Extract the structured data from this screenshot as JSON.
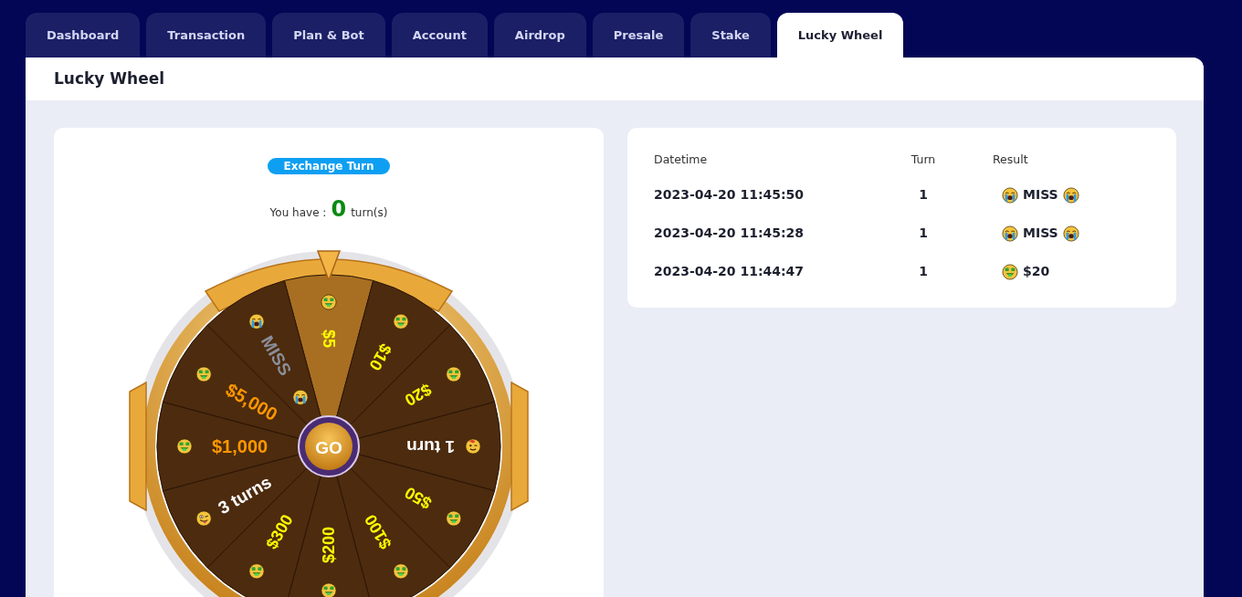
{
  "tabs": [
    {
      "label": "Dashboard",
      "selected": false
    },
    {
      "label": "Transaction",
      "selected": false
    },
    {
      "label": "Plan & Bot",
      "selected": false
    },
    {
      "label": "Account",
      "selected": false
    },
    {
      "label": "Airdrop",
      "selected": false
    },
    {
      "label": "Presale",
      "selected": false
    },
    {
      "label": "Stake",
      "selected": false
    },
    {
      "label": "Lucky Wheel",
      "selected": true
    }
  ],
  "panel": {
    "title": "Lucky Wheel"
  },
  "wheel_card": {
    "exchange_button": "Exchange Turn",
    "turns_label": "You have :",
    "turns_count": "0",
    "turns_unit": "turn(s)",
    "go_button": "GO",
    "segments": [
      {
        "label": "$5",
        "kind": "money",
        "color": "#ffff00",
        "selected": true
      },
      {
        "label": "$10",
        "kind": "money",
        "color": "#ffff00",
        "selected": false
      },
      {
        "label": "$20",
        "kind": "money",
        "color": "#ffff00",
        "selected": false
      },
      {
        "label": "1 turn",
        "kind": "single",
        "color": "#ffffff",
        "selected": false
      },
      {
        "label": "$50",
        "kind": "money",
        "color": "#ffff00",
        "selected": false
      },
      {
        "label": "$100",
        "kind": "money",
        "color": "#ffff00",
        "selected": false
      },
      {
        "label": "$200",
        "kind": "money",
        "color": "#ffff00",
        "selected": false
      },
      {
        "label": "$300",
        "kind": "money",
        "color": "#ffff00",
        "selected": false
      },
      {
        "label": "3 turns",
        "kind": "multi",
        "color": "#ffffff",
        "selected": false
      },
      {
        "label": "$1,000",
        "kind": "money",
        "color": "#ff9800",
        "selected": false
      },
      {
        "label": "$5,000",
        "kind": "money",
        "color": "#ff9800",
        "selected": false
      },
      {
        "label": "MISS",
        "kind": "miss",
        "color": "#8a8f99",
        "selected": false
      }
    ]
  },
  "history": {
    "columns": [
      "Datetime",
      "Turn",
      "Result"
    ],
    "rows": [
      {
        "datetime": "2023-04-20 11:45:50",
        "turn": "1",
        "result": "MISS",
        "kind": "miss"
      },
      {
        "datetime": "2023-04-20 11:45:28",
        "turn": "1",
        "result": "MISS",
        "kind": "miss"
      },
      {
        "datetime": "2023-04-20 11:44:47",
        "turn": "1",
        "result": "$20",
        "kind": "money"
      }
    ]
  }
}
